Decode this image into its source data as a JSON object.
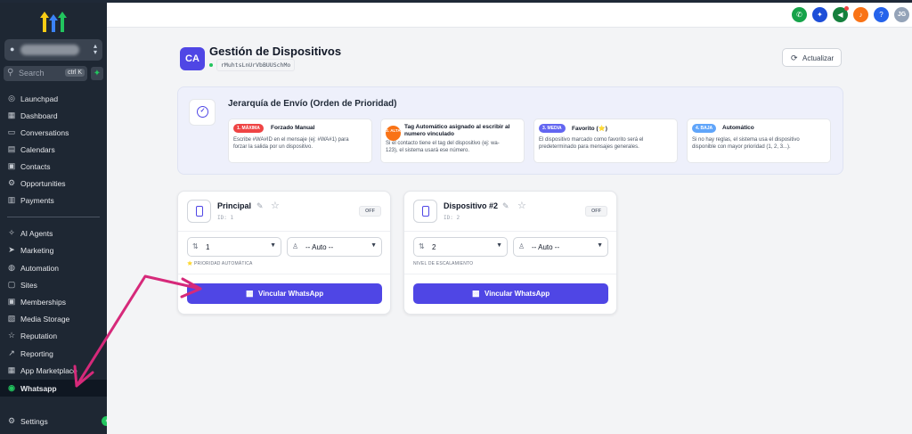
{
  "sidebar": {
    "search": {
      "label": "Search",
      "shortcut": "ctrl K"
    },
    "items_top": [
      {
        "label": "Launchpad",
        "icon": "launchpad-icon"
      },
      {
        "label": "Dashboard",
        "icon": "dashboard-icon"
      },
      {
        "label": "Conversations",
        "icon": "chat-icon"
      },
      {
        "label": "Calendars",
        "icon": "calendar-icon"
      },
      {
        "label": "Contacts",
        "icon": "contacts-icon"
      },
      {
        "label": "Opportunities",
        "icon": "funnel-icon"
      },
      {
        "label": "Payments",
        "icon": "payments-icon"
      }
    ],
    "items_bottom": [
      {
        "label": "AI Agents",
        "icon": "sparkle-icon"
      },
      {
        "label": "Marketing",
        "icon": "send-icon"
      },
      {
        "label": "Automation",
        "icon": "automation-icon"
      },
      {
        "label": "Sites",
        "icon": "sites-icon"
      },
      {
        "label": "Memberships",
        "icon": "memberships-icon"
      },
      {
        "label": "Media Storage",
        "icon": "media-icon"
      },
      {
        "label": "Reputation",
        "icon": "star-icon"
      },
      {
        "label": "Reporting",
        "icon": "chart-icon"
      },
      {
        "label": "App Marketplace",
        "icon": "grid-icon"
      },
      {
        "label": "Whatsapp",
        "icon": "whatsapp-icon",
        "active": true
      }
    ],
    "settings_label": "Settings"
  },
  "header": {
    "buttons": [
      {
        "name": "phone",
        "color": "#16a34a"
      },
      {
        "name": "sparkle",
        "color": "#1d4ed8"
      },
      {
        "name": "megaphone",
        "color": "#15803d"
      },
      {
        "name": "bell",
        "color": "#f97316"
      },
      {
        "name": "help",
        "color": "#2563eb"
      }
    ],
    "user_initials": "JG"
  },
  "page": {
    "avatar": "CA",
    "title": "Gestión de Dispositivos",
    "device_code": "rMuhtsLnUrVbBUUSchMo",
    "refresh_label": "Actualizar"
  },
  "hierarchy": {
    "title": "Jerarquía de Envío (Orden de Prioridad)",
    "levels": [
      {
        "badge": "1. MÁXIMA",
        "color": "#ef4444",
        "title": "Forzado Manual",
        "desc1": "Escribe #WA#ID en el mensaje (ej: #WA#1) para",
        "desc2": "forzar la salida por un dispositivo."
      },
      {
        "badge": "2. ALTA",
        "color": "#f97316",
        "title": "Tag Automático asignado al escribir al numero vinculado",
        "desc1": "Si el contacto tiene el tag del dispositivo (ej: wa-",
        "desc2": "123), el sistema usará ese número."
      },
      {
        "badge": "3. MEDIA",
        "color": "#6366f1",
        "title": "Favorito (⭐)",
        "desc1": "El dispositivo marcado como favorito será el",
        "desc2": "predeterminado para mensajes generales."
      },
      {
        "badge": "4. BAJA",
        "color": "#60a5fa",
        "title": "Automático",
        "desc1": "Si no hay reglas, el sistema usa el dispositivo",
        "desc2": "disponible con mayor prioridad (1, 2, 3...)."
      }
    ]
  },
  "devices": [
    {
      "name": "Principal",
      "id": "ID: 1",
      "status": "OFF",
      "priority": "1",
      "mode": "-- Auto --",
      "hint": "⭐ PRIORIDAD AUTOMÁTICA",
      "link_label": "Vincular WhatsApp"
    },
    {
      "name": "Dispositivo #2",
      "id": "ID: 2",
      "status": "OFF",
      "priority": "2",
      "mode": "-- Auto --",
      "hint": "NIVEL DE ESCALAMIENTO",
      "link_label": "Vincular WhatsApp"
    }
  ],
  "annotation_color": "#d6297a"
}
